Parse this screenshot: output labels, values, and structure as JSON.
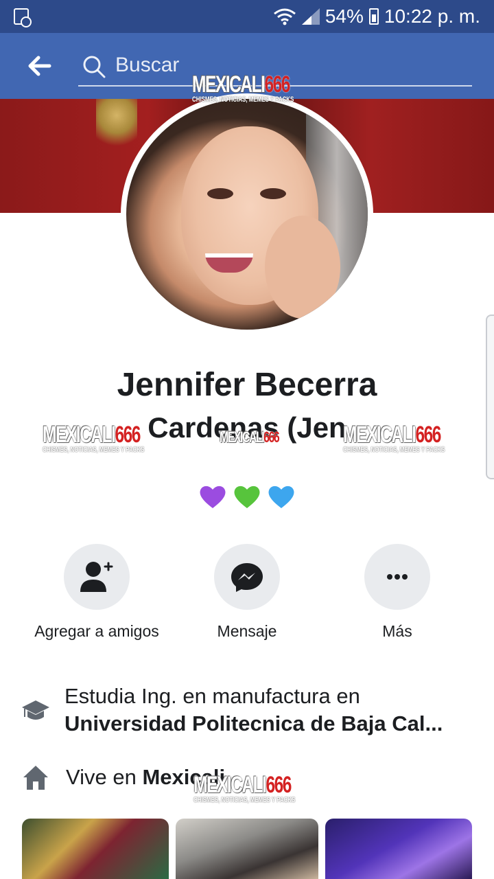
{
  "status_bar": {
    "battery": "54%",
    "time": "10:22 p. m."
  },
  "search_bar": {
    "placeholder": "Buscar"
  },
  "profile": {
    "name": "Jennifer Becerra Cardenas (Jen...)",
    "name_line1": "Jennifer Becerra",
    "name_line2": "Cardenas (Jen",
    "bio_emojis": [
      "purple-heart",
      "green-heart",
      "blue-heart"
    ]
  },
  "actions": [
    {
      "label": "Agregar a amigos",
      "icon": "add-friend-icon"
    },
    {
      "label": "Mensaje",
      "icon": "messenger-icon"
    },
    {
      "label": "Más",
      "icon": "more-icon"
    }
  ],
  "info": {
    "study_prefix": "Estudia Ing. en manufactura en",
    "study_school": "Universidad Politecnica de Baja Cal...",
    "lives_prefix": "Vive en ",
    "lives_city": "Mexicali"
  },
  "watermark": {
    "brand": "MEXICALI",
    "number": "666",
    "tagline": "CHISMES, NOTICIAS, MEMES Y PACKS"
  },
  "colors": {
    "status_bar": "#2d4a8a",
    "header": "#4167b2",
    "text": "#1c1e21",
    "button_bg": "#e9ebee"
  }
}
